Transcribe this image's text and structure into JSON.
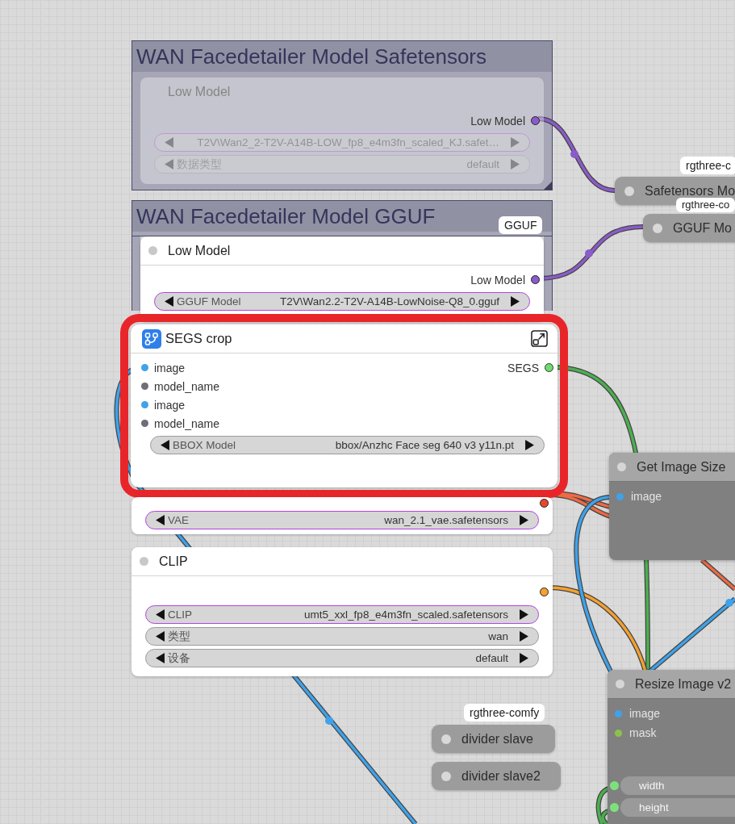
{
  "groups": [
    {
      "title": "WAN Facedetailer Model Safetensors"
    },
    {
      "title": "WAN Facedetailer Model GGUF"
    }
  ],
  "nodes": [
    {
      "kind": "panel",
      "title": "Low Model",
      "dimmed": true,
      "selected": false,
      "outputs": [
        {
          "label": "Low Model",
          "color": "#8a5cc9"
        }
      ],
      "widgets": [
        {
          "value": "T2V\\Wan2_2-T2V-A14B-LOW_fp8_e4m3fn_scaled_KJ.safet…",
          "highlighted": true
        },
        {
          "label": "数据类型",
          "value": "default",
          "highlighted": false
        }
      ]
    },
    {
      "kind": "panel",
      "title": "Low Model",
      "badge": "GGUF",
      "dimmed": false,
      "selected": false,
      "outputs": [
        {
          "label": "Low Model",
          "color": "#8a5cc9"
        }
      ],
      "widgets": [
        {
          "label": "GGUF Model",
          "value": "T2V\\Wan2.2-T2V-A14B-LowNoise-Q8_0.gguf",
          "highlighted": true
        }
      ]
    },
    {
      "kind": "subgraph",
      "title": "SEGS crop",
      "dimmed": false,
      "selected": true,
      "inputs": [
        {
          "label": "image",
          "color": "#3fa2ea"
        },
        {
          "label": "model_name",
          "color": "#6e6e78"
        },
        {
          "label": "image",
          "color": "#3fa2ea"
        },
        {
          "label": "model_name",
          "color": "#6e6e78"
        }
      ],
      "outputs": [
        {
          "label": "SEGS",
          "color": "#6fdc6f"
        }
      ],
      "widgets": [
        {
          "label": "BBOX Model",
          "value": "bbox/Anzhc Face seg 640 v3 y11n.pt",
          "highlighted": false
        }
      ]
    },
    {
      "kind": "hidden-title",
      "dimmed": false,
      "selected": false,
      "outputs": [
        {
          "color": "#e8472e"
        }
      ],
      "widgets": [
        {
          "label": "VAE",
          "value": "wan_2.1_vae.safetensors",
          "highlighted": true
        }
      ]
    },
    {
      "kind": "panel",
      "title": "CLIP",
      "dimmed": false,
      "selected": false,
      "outputs": [
        {
          "color": "#f5a030"
        }
      ],
      "widgets": [
        {
          "label": "CLIP",
          "value": "umt5_xxl_fp8_e4m3fn_scaled.safetensors",
          "highlighted": true
        },
        {
          "label": "类型",
          "value": "wan",
          "highlighted": false
        },
        {
          "label": "设备",
          "value": "default",
          "highlighted": false
        }
      ]
    },
    {
      "kind": "collapsed",
      "title": "Safetensors Mo",
      "badge": "rgthree-c",
      "selected": false
    },
    {
      "kind": "collapsed",
      "title": "GGUF Mo",
      "badge": "rgthree-co",
      "selected": false
    },
    {
      "kind": "grey",
      "title": "Get Image Size",
      "selected": false,
      "inputs": [
        {
          "label": "image",
          "color": "#3fa2ea"
        }
      ]
    },
    {
      "kind": "grey",
      "title": "Resize Image v2",
      "selected": false,
      "inputs": [
        {
          "label": "image",
          "color": "#3fa2ea"
        },
        {
          "label": "mask",
          "color": "#8bc34a"
        }
      ],
      "widgets": [
        {
          "label": "width"
        },
        {
          "label": "height"
        }
      ]
    },
    {
      "kind": "collapsed",
      "title": "divider slave",
      "badge": "rgthree-comfy",
      "selected": false
    },
    {
      "kind": "collapsed",
      "title": "divider slave2",
      "selected": false
    }
  ]
}
